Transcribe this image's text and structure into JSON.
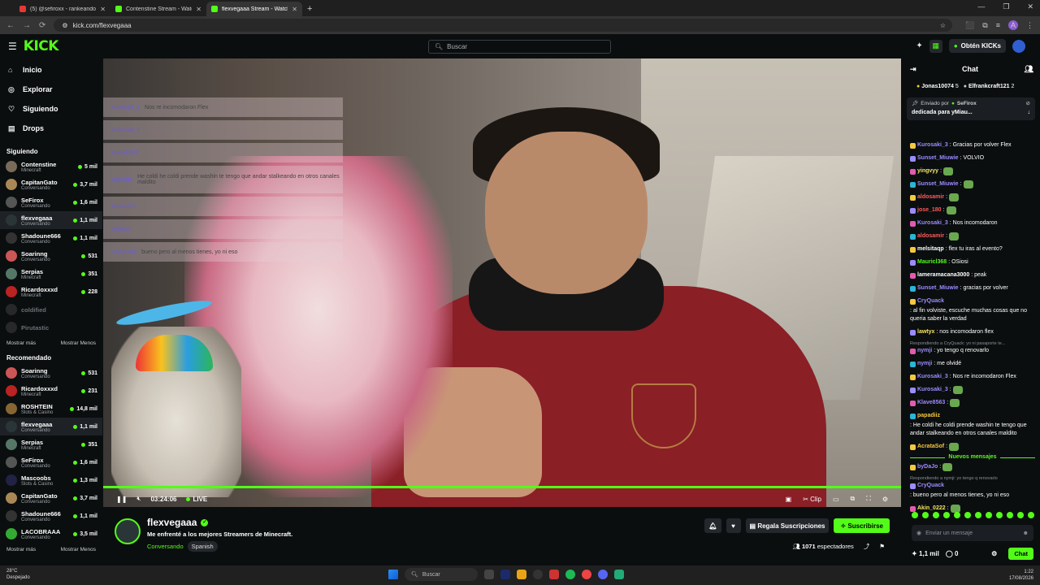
{
  "browser": {
    "tabs": [
      {
        "title": "(5) @sefiroxx - rankeando (Wi",
        "color": "#e53935"
      },
      {
        "title": "Contenstine Stream - Watch Liv",
        "color": "#53fc18"
      },
      {
        "title": "flexvegaaa Stream - Watch Liv",
        "color": "#53fc18"
      }
    ],
    "url": "kick.com/flexvegaaa",
    "profile_initial": "A"
  },
  "topbar": {
    "logo": "KICK",
    "search_placeholder": "Buscar",
    "get_kicks": "Obtén KICKs"
  },
  "sidebar": {
    "nav": [
      {
        "label": "Inicio",
        "icon": "home-icon"
      },
      {
        "label": "Explorar",
        "icon": "compass-icon"
      },
      {
        "label": "Siguiendo",
        "icon": "heart-icon"
      },
      {
        "label": "Drops",
        "icon": "gift-icon"
      }
    ],
    "following_title": "Siguiendo",
    "following": [
      {
        "name": "Contenstine",
        "cat": "Minecraft",
        "viewers": "5 mil",
        "color": "#7a6a5a",
        "online": true
      },
      {
        "name": "CapitanGato",
        "cat": "Conversando",
        "viewers": "3,7 mil",
        "color": "#a85",
        "online": true
      },
      {
        "name": "SeFirox",
        "cat": "Conversando",
        "viewers": "1,6 mil",
        "color": "#555",
        "online": true
      },
      {
        "name": "flexvegaaa",
        "cat": "Conversando",
        "viewers": "1,1 mil",
        "color": "#2a3538",
        "online": true
      },
      {
        "name": "Shadoune666",
        "cat": "Conversando",
        "viewers": "1,1 mil",
        "color": "#333",
        "online": true
      },
      {
        "name": "Soarinng",
        "cat": "Conversando",
        "viewers": "531",
        "color": "#c55",
        "online": true
      },
      {
        "name": "Serpias",
        "cat": "Minecraft",
        "viewers": "351",
        "color": "#576",
        "online": true
      },
      {
        "name": "Ricardoxxxd",
        "cat": "Minecraft",
        "viewers": "228",
        "color": "#b22",
        "online": true
      },
      {
        "name": "coldified",
        "cat": "",
        "viewers": "",
        "color": "#444",
        "online": false
      },
      {
        "name": "Pirutastic",
        "cat": "",
        "viewers": "",
        "color": "#444",
        "online": false
      }
    ],
    "show_more": "Mostrar más",
    "show_less": "Mostrar Menos",
    "recommended_title": "Recomendado",
    "recommended": [
      {
        "name": "Soarinng",
        "cat": "Conversando",
        "viewers": "531",
        "color": "#c55"
      },
      {
        "name": "Ricardoxxxd",
        "cat": "Minecraft",
        "viewers": "231",
        "color": "#b22"
      },
      {
        "name": "ROSHTEIN",
        "cat": "Slots & Casino",
        "viewers": "14,8 mil",
        "color": "#863"
      },
      {
        "name": "flexvegaaa",
        "cat": "Conversando",
        "viewers": "1,1 mil",
        "color": "#2a3538"
      },
      {
        "name": "Serpias",
        "cat": "Minecraft",
        "viewers": "351",
        "color": "#576"
      },
      {
        "name": "SeFirox",
        "cat": "Conversando",
        "viewers": "1,6 mil",
        "color": "#555"
      },
      {
        "name": "Mascoobs",
        "cat": "Slots & Casino",
        "viewers": "1,3 mil",
        "color": "#224"
      },
      {
        "name": "CapitanGato",
        "cat": "Conversando",
        "viewers": "3,7 mil",
        "color": "#a85"
      },
      {
        "name": "Shadoune666",
        "cat": "Conversando",
        "viewers": "1,1 mil",
        "color": "#333"
      },
      {
        "name": "LACOBRAAA",
        "cat": "Conversando",
        "viewers": "3,5 mil",
        "color": "#3a3"
      }
    ]
  },
  "player": {
    "overlay_chat": [
      {
        "user": "Kurosaki_3",
        "text": "Nos re incomodaron Flex"
      },
      {
        "user": "Kurosaki_3",
        "text": ""
      },
      {
        "user": "Klave8563",
        "text": ""
      },
      {
        "user": "papadiiz",
        "text": "He coldi he coldi prende washin te tengo que andar stalkeando en otros canales maldito"
      },
      {
        "user": "AcrataSof",
        "text": ""
      },
      {
        "user": "byDaJo",
        "text": ""
      },
      {
        "user": "CryQuack",
        "text": "bueno pero al menos tienes, yo ni eso"
      }
    ],
    "time": "03:24:06",
    "live": "LIVE",
    "clip": "Clip"
  },
  "channel": {
    "name": "flexvegaaa",
    "title": "Me enfrenté a los mejores Streamers de Minecraft.",
    "category": "Conversando",
    "tag": "Spanish",
    "gift_subs": "Regala Suscripciones",
    "subscribe": "Suscribirse",
    "viewers": "1071",
    "viewers_label": "espectadores"
  },
  "chat": {
    "title": "Chat",
    "gifters": [
      {
        "name": "Jonas10074",
        "count": "5"
      },
      {
        "name": "Elfrankcraft121",
        "count": "2"
      }
    ],
    "pinned_by_label": "Enviado por",
    "pinned_by": "SeFirox",
    "pinned_text": "dedicada para yMiau...",
    "messages": [
      {
        "user": "Kurosaki_3",
        "text": ": Gracias por volver Flex",
        "color": "#9b8cff",
        "reply": ""
      },
      {
        "user": "Sunset_Miuwie",
        "text": ": VOLVIO",
        "color": "#9b8cff",
        "reply": ""
      },
      {
        "user": "yingvyy",
        "text": ":",
        "color": "#f5e663",
        "reply": ""
      },
      {
        "user": "Sunset_Miuwie",
        "text": ":",
        "color": "#9b8cff",
        "reply": ""
      },
      {
        "user": "aldosamir",
        "text": ":",
        "color": "#ff5b5b",
        "reply": ""
      },
      {
        "user": "jose_180",
        "text": ":",
        "color": "#ff5b5b",
        "reply": ""
      },
      {
        "user": "Kurosaki_3",
        "text": ": Nos incomodaron",
        "color": "#9b8cff",
        "reply": ""
      },
      {
        "user": "aldosamir",
        "text": ":",
        "color": "#ff5b5b",
        "reply": ""
      },
      {
        "user": "melsitaqp",
        "text": ": flex tu iras al evento?",
        "color": "#fff",
        "reply": ""
      },
      {
        "user": "Mauricl368",
        "text": ": OSiosi",
        "color": "#53fc18",
        "reply": ""
      },
      {
        "user": "lameramacana3000",
        "text": ": peak",
        "color": "#fff",
        "reply": ""
      },
      {
        "user": "Sunset_Miuwie",
        "text": ": gracias por volver",
        "color": "#9b8cff",
        "reply": ""
      },
      {
        "user": "CryQuack",
        "text": ": al fin volviste, escuche muchas cosas que no queria saber la verdad",
        "color": "#9b8cff",
        "reply": ""
      },
      {
        "user": "lawtyx",
        "text": ": nos incomodaron flex",
        "color": "#f5e663",
        "reply": ""
      },
      {
        "user": "nymji",
        "text": ": yo tengo q renovarlo",
        "color": "#9b8cff",
        "reply": "Respondiendo a CryQuack: yo ni pasaporte te..."
      },
      {
        "user": "nymji",
        "text": ": me olvidé",
        "color": "#9b8cff",
        "reply": ""
      },
      {
        "user": "Kurosaki_3",
        "text": ": Nos re incomodaron Flex",
        "color": "#9b8cff",
        "reply": ""
      },
      {
        "user": "Kurosaki_3",
        "text": ":",
        "color": "#9b8cff",
        "reply": ""
      },
      {
        "user": "Klave8563",
        "text": ":",
        "color": "#9b8cff",
        "reply": ""
      },
      {
        "user": "papadiiz",
        "text": ": He coldi he coldi prende washin te tengo que andar stalkeando en otros canales maldito",
        "color": "#f5c842",
        "reply": ""
      },
      {
        "user": "AcrataSof",
        "text": ":",
        "color": "#f5c842",
        "reply": ""
      }
    ],
    "new_messages": "Nuevos mensajes",
    "new_msgs": [
      {
        "user": "byDaJo",
        "text": ":",
        "color": "#9b8cff",
        "reply": ""
      },
      {
        "user": "CryQuack",
        "text": ": bueno pero al menos tienes, yo ni eso",
        "color": "#9b8cff",
        "reply": "Respondiendo a nymji: yo tengo q renovarlo"
      },
      {
        "user": "Akin_0222",
        "text": ":",
        "color": "#f5e663",
        "reply": ""
      }
    ],
    "input_placeholder": "Enviar un mensaje",
    "kicks": "1,1 mil",
    "points": "0",
    "chat_button": "Chat"
  },
  "taskbar": {
    "temp": "28°C",
    "weather": "Despejado",
    "search": "Buscar",
    "time": "1:22",
    "date": "17/08/2026"
  }
}
